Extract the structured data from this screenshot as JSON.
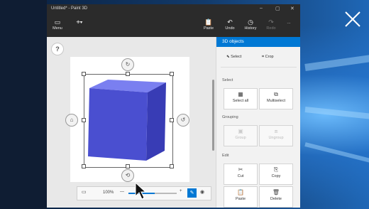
{
  "window": {
    "title": "Untitled* - Paint 3D",
    "controls": [
      "–",
      "▢",
      "✕"
    ]
  },
  "toolbar": {
    "menu": "Menu",
    "paste": "Paste",
    "undo": "Undo",
    "history": "History",
    "redo": "Redo",
    "more": "···"
  },
  "canvas": {
    "help": "?",
    "object_color": "#4a4fd0"
  },
  "zoom": {
    "level": "100%",
    "minus": "—",
    "plus": "+",
    "slider_fraction": 0.55
  },
  "panel": {
    "title": "3D objects",
    "select": "Select",
    "crop": "Crop",
    "section_select": "Select",
    "select_all": "Select all",
    "multiselect": "Multiselect",
    "section_grouping": "Grouping",
    "group": "Group",
    "ungroup": "Ungroup",
    "section_edit": "Edit",
    "cut": "Cut",
    "copy": "Copy",
    "paste": "Paste",
    "delete": "Delete"
  }
}
